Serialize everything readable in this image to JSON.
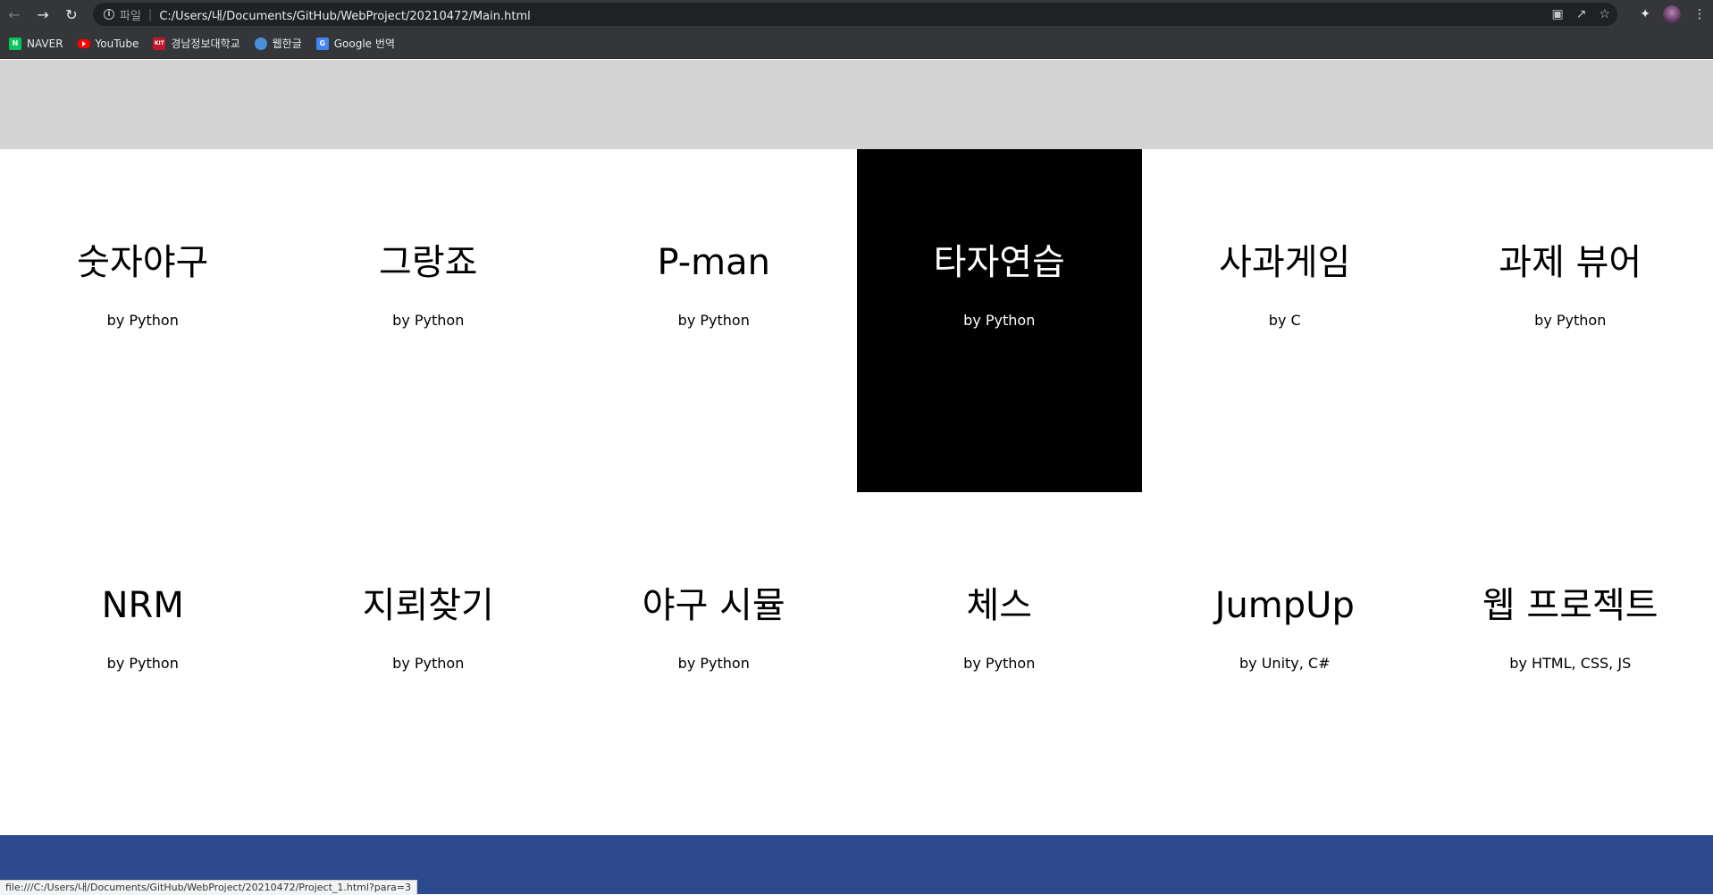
{
  "browser": {
    "scheme_label": "파일",
    "url": "C:/Users/내/Documents/GitHub/WebProject/20210472/Main.html",
    "status_url": "file:///C:/Users/내/Documents/GitHub/WebProject/20210472/Project_1.html?para=3",
    "icons": {
      "back": "back-arrow-icon",
      "forward": "forward-arrow-icon",
      "reload": "reload-icon",
      "info": "info-icon",
      "translate": "translate-icon",
      "share": "share-icon",
      "star": "star-icon",
      "extensions": "puzzle-icon",
      "menu": "kebab-menu-icon"
    }
  },
  "bookmarks": [
    {
      "label": "NAVER",
      "icon": "naver-icon",
      "favicon_text": "N"
    },
    {
      "label": "YouTube",
      "icon": "youtube-icon",
      "favicon_text": ""
    },
    {
      "label": "경남정보대학교",
      "icon": "kniu-icon",
      "favicon_text": "KIT"
    },
    {
      "label": "웹한글",
      "icon": "web-hangul-icon",
      "favicon_text": ""
    },
    {
      "label": "Google 번역",
      "icon": "google-translate-icon",
      "favicon_text": "G"
    }
  ],
  "projects_row1": [
    {
      "title": "숫자야구",
      "subtitle": "by Python"
    },
    {
      "title": "그랑죠",
      "subtitle": "by Python"
    },
    {
      "title": "P-man",
      "subtitle": "by Python"
    },
    {
      "title": "타자연습",
      "subtitle": "by Python"
    },
    {
      "title": "사과게임",
      "subtitle": "by C"
    },
    {
      "title": "과제 뷰어",
      "subtitle": "by Python"
    }
  ],
  "projects_row2": [
    {
      "title": "NRM",
      "subtitle": "by Python"
    },
    {
      "title": "지뢰찾기",
      "subtitle": "by Python"
    },
    {
      "title": "야구 시뮬",
      "subtitle": "by Python"
    },
    {
      "title": "체스",
      "subtitle": "by Python"
    },
    {
      "title": "JumpUp",
      "subtitle": "by Unity, C#"
    },
    {
      "title": "웹 프로젝트",
      "subtitle": "by HTML, CSS, JS"
    }
  ],
  "colors": {
    "header_band": "#d3d3d3",
    "footer_band": "#2c4a8d",
    "active_card_bg": "#000000",
    "active_card_fg": "#ffffff"
  }
}
